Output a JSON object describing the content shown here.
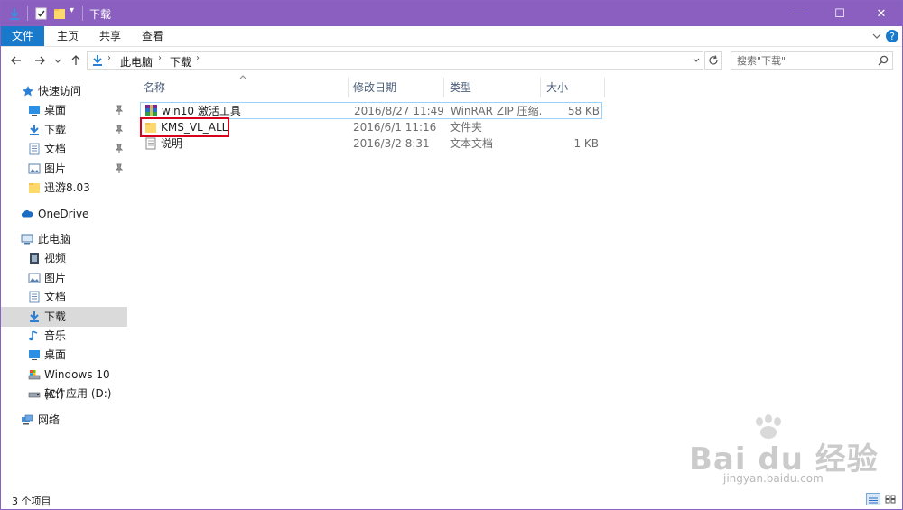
{
  "window": {
    "title": "下载",
    "controls": {
      "minimize": "—",
      "maximize": "☐",
      "close": "✕"
    }
  },
  "ribbon": {
    "tabs": [
      "文件",
      "主页",
      "共享",
      "查看"
    ],
    "collapse_icon": "chevron-down-icon",
    "help_icon": "help-icon",
    "help_glyph": "?"
  },
  "address": {
    "breadcrumbs": [
      "此电脑",
      "下载"
    ],
    "search_placeholder": "搜索\"下载\""
  },
  "nav": {
    "quick_access": "快速访问",
    "quick_items": [
      {
        "label": "桌面",
        "pinned": true
      },
      {
        "label": "下载",
        "pinned": true
      },
      {
        "label": "文档",
        "pinned": true
      },
      {
        "label": "图片",
        "pinned": true
      },
      {
        "label": "迅游8.03",
        "pinned": false
      }
    ],
    "onedrive": "OneDrive",
    "this_pc": "此电脑",
    "pc_items": [
      "视频",
      "图片",
      "文档",
      "下载",
      "音乐",
      "桌面",
      "Windows 10 (C:)",
      "软件应用 (D:)"
    ],
    "network": "网络",
    "selected": "下载"
  },
  "columns": {
    "name": "名称",
    "modified": "修改日期",
    "type": "类型",
    "size": "大小"
  },
  "files": [
    {
      "name": "win10 激活工具",
      "modified": "2016/8/27 11:49",
      "type": "WinRAR ZIP 压缩...",
      "size": "58 KB",
      "icon": "winrar-archive-icon"
    },
    {
      "name": "KMS_VL_ALL",
      "modified": "2016/6/1 11:16",
      "type": "文件夹",
      "size": "",
      "icon": "folder-icon"
    },
    {
      "name": "说明",
      "modified": "2016/3/2 8:31",
      "type": "文本文档",
      "size": "1 KB",
      "icon": "text-document-icon"
    }
  ],
  "status": {
    "item_count": "3 个项目"
  },
  "watermark": {
    "brand": "Bai du 经验",
    "url": "jingyan.baidu.com"
  },
  "colors": {
    "title_bar": "#8b5fbf",
    "file_tab": "#1979ca",
    "highlight_border": "#d9001b",
    "selection": "#dadada"
  }
}
